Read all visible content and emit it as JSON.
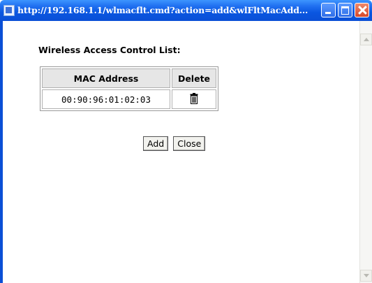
{
  "window": {
    "title": "http://192.168.1.1/wlmacflt.cmd?action=add&wlFltMacAdd..."
  },
  "page": {
    "heading": "Wireless Access Control List:",
    "table": {
      "headers": [
        "MAC Address",
        "Delete"
      ],
      "rows": [
        {
          "mac": "00:90:96:01:02:03",
          "delete_icon": "trash-icon"
        }
      ]
    },
    "buttons": {
      "add": "Add",
      "close": "Close"
    }
  },
  "colors": {
    "titlebar": "#0a56e0",
    "close_button": "#d6482a"
  }
}
